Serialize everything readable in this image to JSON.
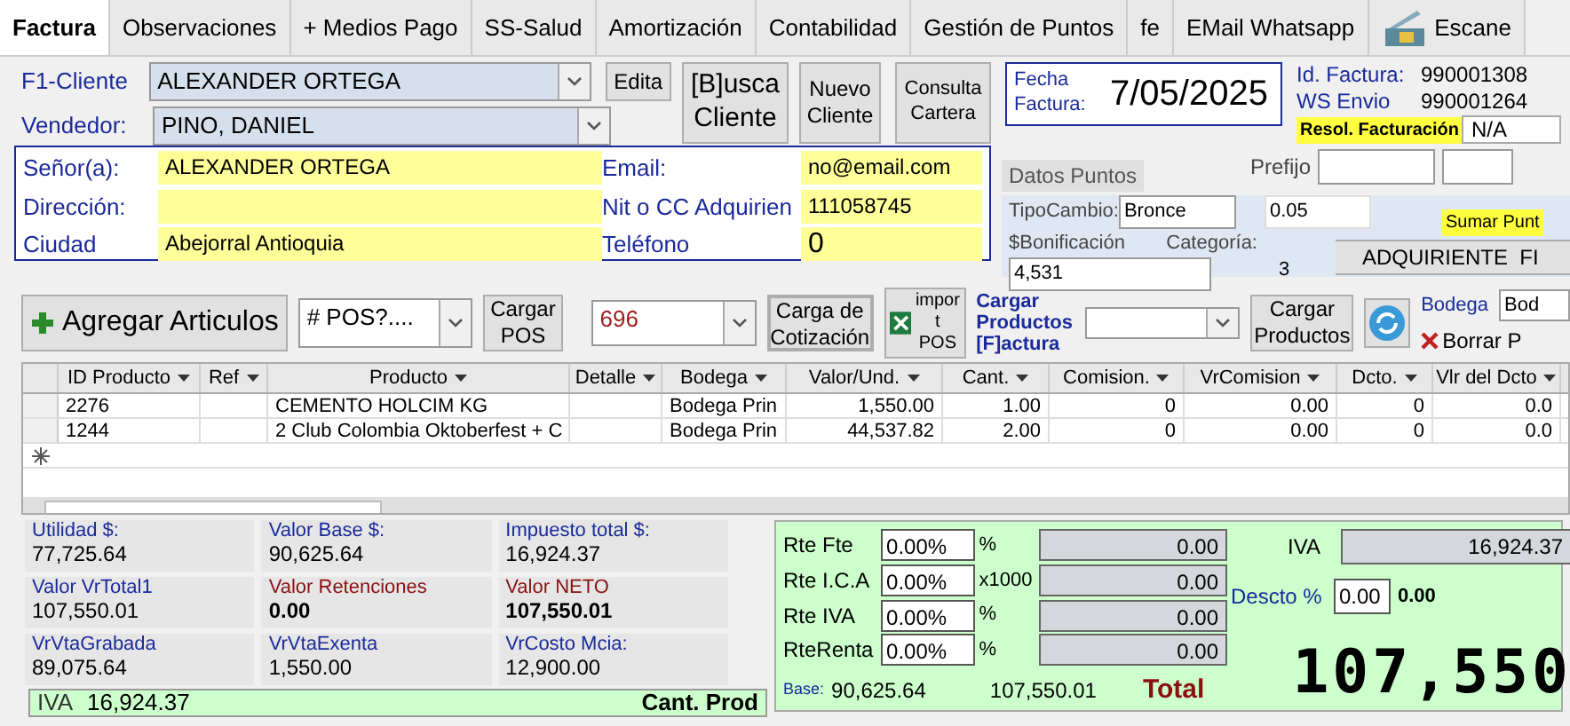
{
  "tabs": [
    {
      "label": "Factura",
      "selected": true
    },
    {
      "label": "Observaciones",
      "selected": false
    },
    {
      "label": "+ Medios Pago",
      "selected": false
    },
    {
      "label": "SS-Salud",
      "selected": false
    },
    {
      "label": "Amortización",
      "selected": false
    },
    {
      "label": "Contabilidad",
      "selected": false
    },
    {
      "label": "Gestión de Puntos",
      "selected": false
    },
    {
      "label": "fe",
      "selected": false
    },
    {
      "label": "EMail Whatsapp",
      "selected": false
    },
    {
      "label": "Escane",
      "selected": false,
      "kind": "scanner"
    }
  ],
  "header": {
    "client_label": "F1-Cliente",
    "client": "ALEXANDER ORTEGA",
    "edit_button": "Edita",
    "vendor_label": "Vendedor:",
    "vendor": "PINO, DANIEL",
    "buttons": [
      "[B]usca Cliente",
      "Nuevo Cliente",
      "Consulta Cartera"
    ],
    "date_label": "Fecha Factura:",
    "date": "7/05/2025",
    "invoice_id_label": "Id. Factura:",
    "invoice_id": "990001308",
    "ws_label": "WS Envio",
    "ws": "990001264",
    "resolution_label": "Resol. Facturación",
    "resolution": "N/A",
    "prefix_label": "Prefijo"
  },
  "customer": [
    {
      "label": "Señor(a):",
      "value": "ALEXANDER ORTEGA"
    },
    {
      "label": "Email:",
      "value": "no@email.com"
    },
    {
      "label": "Dirección:"
    },
    {
      "label": "Nit o CC Adquirien",
      "value": "111058745"
    },
    {
      "label": "Ciudad",
      "value": "Abejorral  Antioquia"
    },
    {
      "label": "Teléfono",
      "value": "0"
    }
  ],
  "points": {
    "title": "Datos Puntos",
    "type_label": "TipoCambio:",
    "type": "Bronce",
    "rate": "0.05",
    "bonus_label": "$Bonificación",
    "bonus": "4,531",
    "category_label": "Categoría:",
    "category": "3",
    "add_points": "Sumar Punt",
    "buyer_button": "ADQUIRIENTE  FI"
  },
  "toolbar": {
    "add_button": "Agregar Articulos",
    "pos_combo": "# POS?....",
    "load_pos": "Cargar POS",
    "quote_combo": "696",
    "load_quote": "Carga de Cotización",
    "import_pos": "impor t POS",
    "load_products_label": "Cargar Productos [F]actura",
    "load_products": "Cargar Productos",
    "warehouse_label": "Bodega",
    "warehouse": "Bod",
    "delete_button": "Borrar P"
  },
  "grid": {
    "columns": [
      "ID Producto",
      "Ref",
      "Producto",
      "Detalle",
      "Bodega",
      "Valor/Und.",
      "Cant.",
      "Comision.",
      "VrComision",
      "Dcto.",
      "Vlr del Dcto"
    ],
    "rows": [
      [
        "2276",
        null,
        "CEMENTO HOLCIM KG",
        null,
        "Bodega Prin",
        "1,550.00",
        "1.00",
        "0",
        "0.00",
        "0",
        "0.0"
      ],
      [
        "1244",
        null,
        "2 Club Colombia Oktoberfest + C",
        null,
        "Bodega Prin",
        "44,537.82",
        "2.00",
        "0",
        "0.00",
        "0",
        "0.0"
      ]
    ]
  },
  "stats": [
    {
      "label": "Utilidad $:",
      "value": "77,725.64",
      "emphasis": false
    },
    {
      "label": "Valor Base $:",
      "value": "90,625.64",
      "emphasis": false
    },
    {
      "label": "Impuesto total $:",
      "value": "16,924.37",
      "emphasis": false
    },
    {
      "label": "Valor VrTotal1",
      "value": "107,550.01",
      "emphasis": false
    },
    {
      "label": "Valor Retenciones",
      "value": "0.00",
      "emphasis": true
    },
    {
      "label": "Valor NETO",
      "value": "107,550.01",
      "emphasis": true
    },
    {
      "label": "VrVtaGrabada",
      "value": "89,075.64",
      "emphasis": false
    },
    {
      "label": "VrVtaExenta",
      "value": "1,550.00",
      "emphasis": false
    },
    {
      "label": "VrCosto Mcia:",
      "value": "12,900.00",
      "emphasis": false
    }
  ],
  "strip": {
    "iva_label": "IVA",
    "iva": "16,924.37",
    "count_label": "Cant. Prod"
  },
  "totals": {
    "retentions": [
      {
        "label": "Rte Fte",
        "rate": "0.00%",
        "unit": "%",
        "amount": "0.00"
      },
      {
        "label": "Rte I.C.A",
        "rate": "0.00%",
        "unit": "x1000",
        "amount": "0.00"
      },
      {
        "label": "Rte IVA",
        "rate": "0.00%",
        "unit": "%",
        "amount": "0.00"
      },
      {
        "label": "RteRenta",
        "rate": "0.00%",
        "unit": "%",
        "amount": "0.00"
      }
    ],
    "iva_label": "IVA",
    "iva": "16,924.37",
    "discount_label": "Descto %",
    "discount": "0.00",
    "discount_value": "0.00",
    "base_label": "Base:",
    "base": "90,625.64",
    "subtotal": "107,550.01",
    "total_label": "Total",
    "total_display": "107,550"
  }
}
